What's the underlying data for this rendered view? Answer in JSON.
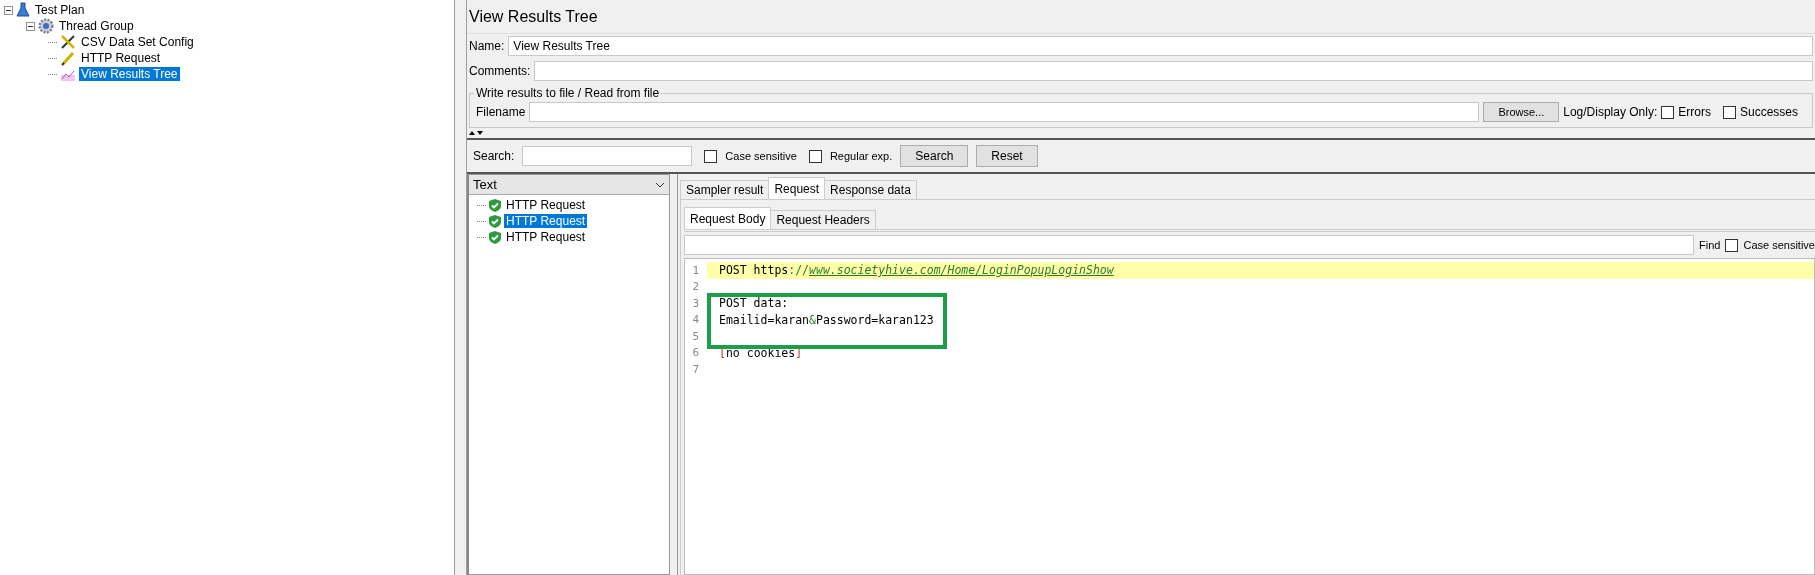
{
  "test_tree": [
    {
      "label": "Test Plan",
      "kind": "flask",
      "expanded": true,
      "selected": false,
      "children": [
        {
          "label": "Thread Group",
          "kind": "gear",
          "expanded": true,
          "selected": false,
          "children": [
            {
              "label": "CSV Data Set Config",
              "kind": "tools",
              "selected": false
            },
            {
              "label": "HTTP Request",
              "kind": "pipette",
              "selected": false
            },
            {
              "label": "View Results Tree",
              "kind": "graph",
              "selected": true
            }
          ]
        }
      ]
    }
  ],
  "panel": {
    "title": "View Results Tree",
    "name_label": "Name:",
    "name_value": "View Results Tree",
    "comments_label": "Comments:",
    "file_group": {
      "legend": "Write results to file / Read from file",
      "filename_label": "Filename",
      "browse": "Browse...",
      "log_label": "Log/Display Only:",
      "options": [
        {
          "label": "Errors",
          "checked": false
        },
        {
          "label": "Successes",
          "checked": false
        }
      ]
    },
    "search": {
      "label": "Search:",
      "options": [
        {
          "label": "Case sensitive",
          "checked": false
        },
        {
          "label": "Regular exp.",
          "checked": false
        }
      ],
      "buttons": [
        "Search",
        "Reset"
      ]
    },
    "renderer": "Text",
    "results": [
      {
        "label": "HTTP Request",
        "selected": false
      },
      {
        "label": "HTTP Request",
        "selected": true
      },
      {
        "label": "HTTP Request",
        "selected": false
      }
    ],
    "tabs": [
      {
        "label": "Sampler result",
        "selected": false
      },
      {
        "label": "Request",
        "selected": true
      },
      {
        "label": "Response data",
        "selected": false
      }
    ],
    "subtabs": [
      {
        "label": "Request Body",
        "selected": true
      },
      {
        "label": "Request Headers",
        "selected": false
      }
    ],
    "find": {
      "label": "Find",
      "case_label": "Case sensitive",
      "case_checked": false
    },
    "code_lines": [
      {
        "number": "1",
        "highlighted": true,
        "segments": [
          {
            "kind": "plain",
            "text": "POST https"
          },
          {
            "kind": "punct",
            "text": "://"
          },
          {
            "kind": "link",
            "text": "www.societyhive.com/Home/LoginPopupLoginShow"
          }
        ]
      },
      {
        "number": "2",
        "highlighted": false
      },
      {
        "number": "3",
        "highlighted": false,
        "segments": [
          {
            "kind": "plain",
            "text": "POST data:"
          }
        ]
      },
      {
        "number": "4",
        "highlighted": false,
        "segments": [
          {
            "kind": "plain",
            "text": "Emailid=karan"
          },
          {
            "kind": "punct",
            "text": "&"
          },
          {
            "kind": "plain",
            "text": "Password=karan123"
          }
        ]
      },
      {
        "number": "5",
        "highlighted": false
      },
      {
        "number": "6",
        "highlighted": false,
        "segments": [
          {
            "kind": "bracket",
            "text": "["
          },
          {
            "kind": "plain",
            "text": "no cookies"
          },
          {
            "kind": "bracket",
            "text": "]"
          }
        ]
      },
      {
        "number": "7",
        "highlighted": false
      }
    ]
  }
}
